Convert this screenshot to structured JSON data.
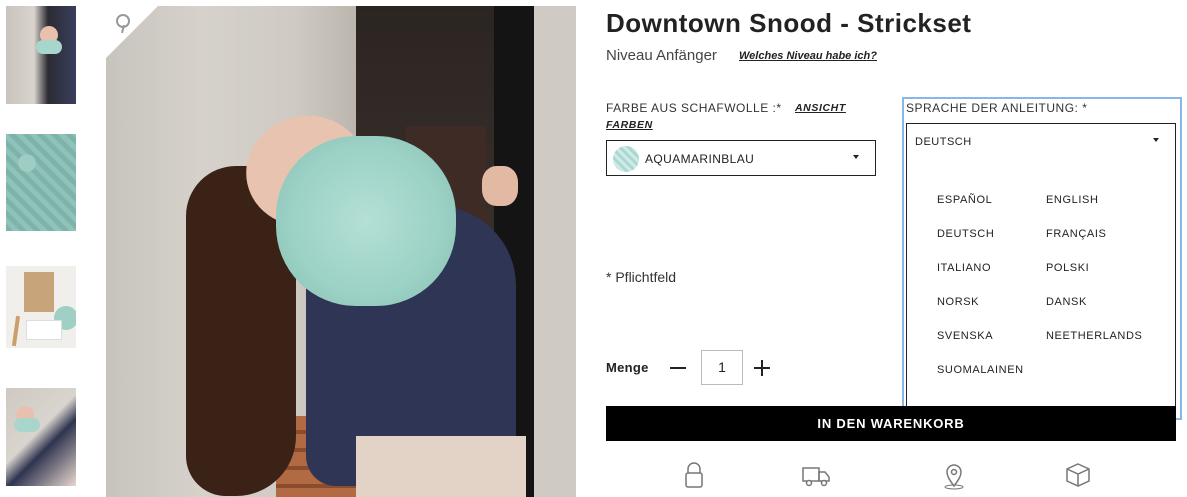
{
  "product": {
    "title": "Downtown Snood - Strickset",
    "level": "Niveau Anfänger",
    "level_link": "Welches Niveau habe ich?"
  },
  "color": {
    "label": "FARBE AUS SCHAFWOLLE :*",
    "link_line1": "ANSICHT",
    "link_line2": "FARBEN",
    "selected": "AQUAMARINBLAU"
  },
  "language": {
    "label": "SPRACHE DER ANLEITUNG: *",
    "selected": "DEUTSCH",
    "options_col1": [
      "ESPAÑOL",
      "DEUTSCH",
      "ITALIANO",
      "NORSK",
      "SVENSKA",
      "SUOMALAINEN"
    ],
    "options_col2": [
      "ENGLISH",
      "FRANÇAIS",
      "POLSKI",
      "DANSK",
      "NEETHERLANDS"
    ]
  },
  "form": {
    "required_note": "* Pflichtfeld"
  },
  "quantity": {
    "label": "Menge",
    "value": "1"
  },
  "cart": {
    "button_label": "IN DEN WARENKORB"
  },
  "icons": {
    "pinterest": "pinterest-icon",
    "features": [
      "lock-icon",
      "delivery-truck-icon",
      "location-pin-icon",
      "package-icon"
    ]
  }
}
